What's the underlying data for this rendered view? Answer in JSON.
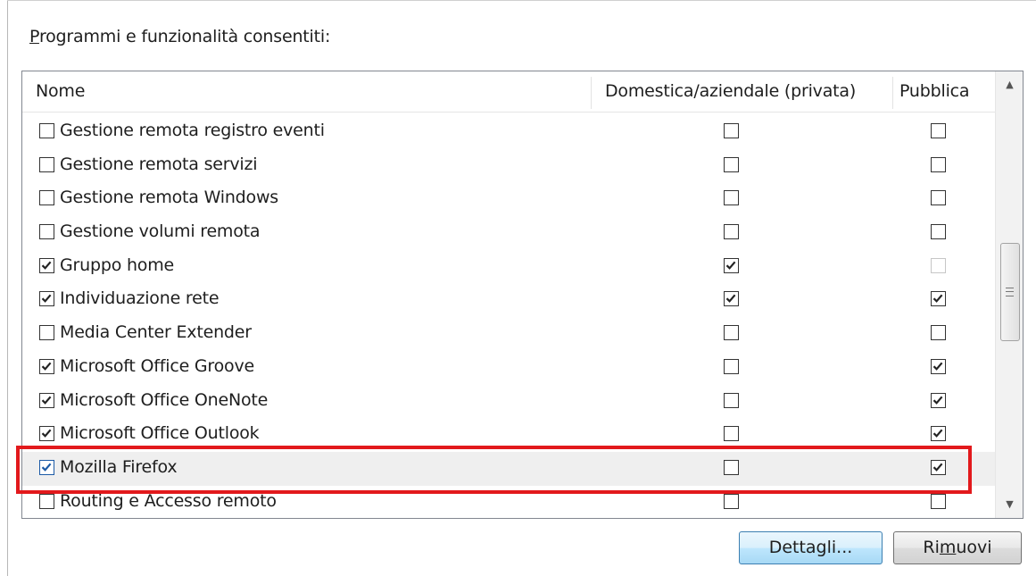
{
  "section": {
    "label_pre": "",
    "label_accel": "P",
    "label_post": "rogrammi e funzionalità consentiti:"
  },
  "table": {
    "headers": {
      "name": "Nome",
      "home": "Domestica/aziendale (privata)",
      "public": "Pubblica"
    },
    "rows": [
      {
        "name": "Gestione remota registro eventi",
        "enabled": false,
        "home": false,
        "public": false
      },
      {
        "name": "Gestione remota servizi",
        "enabled": false,
        "home": false,
        "public": false
      },
      {
        "name": "Gestione remota Windows",
        "enabled": false,
        "home": false,
        "public": false
      },
      {
        "name": "Gestione volumi remota",
        "enabled": false,
        "home": false,
        "public": false
      },
      {
        "name": "Gruppo home",
        "enabled": true,
        "home": true,
        "public": false,
        "public_disabled": true
      },
      {
        "name": "Individuazione rete",
        "enabled": true,
        "home": true,
        "public": true
      },
      {
        "name": "Media Center Extender",
        "enabled": false,
        "home": false,
        "public": false
      },
      {
        "name": "Microsoft Office Groove",
        "enabled": true,
        "home": false,
        "public": true
      },
      {
        "name": "Microsoft Office OneNote",
        "enabled": true,
        "home": false,
        "public": true
      },
      {
        "name": "Microsoft Office Outlook",
        "enabled": true,
        "home": false,
        "public": true
      },
      {
        "name": "Mozilla Firefox",
        "enabled": true,
        "home": false,
        "public": true,
        "selected": true
      },
      {
        "name": "Routing e Accesso remoto",
        "enabled": false,
        "home": false,
        "public": false
      }
    ]
  },
  "scrollbar": {
    "up_icon": "scroll-up-arrow-icon",
    "down_icon": "scroll-down-arrow-icon",
    "up_glyph": "▲",
    "down_glyph": "▼"
  },
  "buttons": {
    "details": "Dettagli...",
    "remove_pre": "Ri",
    "remove_accel": "m",
    "remove_post": "uovi"
  },
  "colors": {
    "highlight": "#e2191c",
    "selected_row": "#efefef",
    "check_blue": "#1c5aa6"
  }
}
